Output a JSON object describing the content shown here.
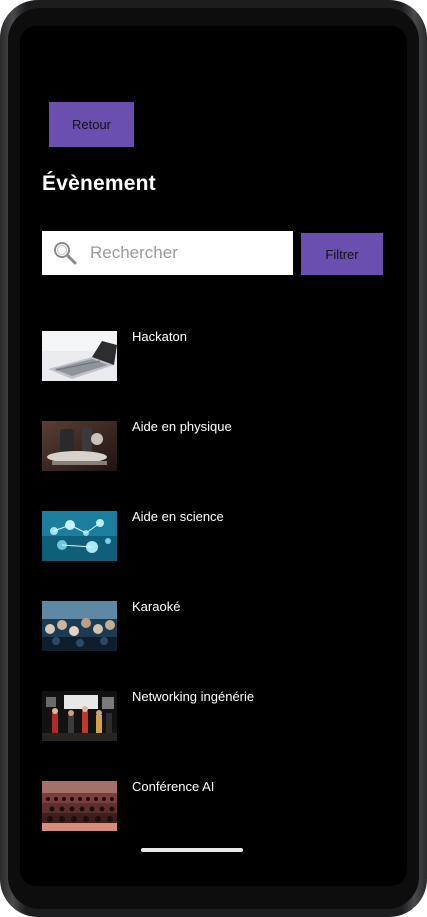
{
  "header": {
    "back_label": "Retour",
    "title": "Évènement"
  },
  "search": {
    "placeholder": "Rechercher",
    "value": "",
    "filter_label": "Filtrer"
  },
  "events": [
    {
      "label": "Hackaton",
      "image": "laptop-photo"
    },
    {
      "label": "Aide en physique",
      "image": "microscope-photo"
    },
    {
      "label": "Aide en science",
      "image": "molecules-photo"
    },
    {
      "label": "Karaoké",
      "image": "concert-crowd-photo"
    },
    {
      "label": "Networking ingénérie",
      "image": "networking-event-photo"
    },
    {
      "label": "Conférence AI",
      "image": "auditorium-photo"
    }
  ],
  "colors": {
    "accent": "#6a4fb0",
    "background": "#000000",
    "text": "#ffffff"
  }
}
